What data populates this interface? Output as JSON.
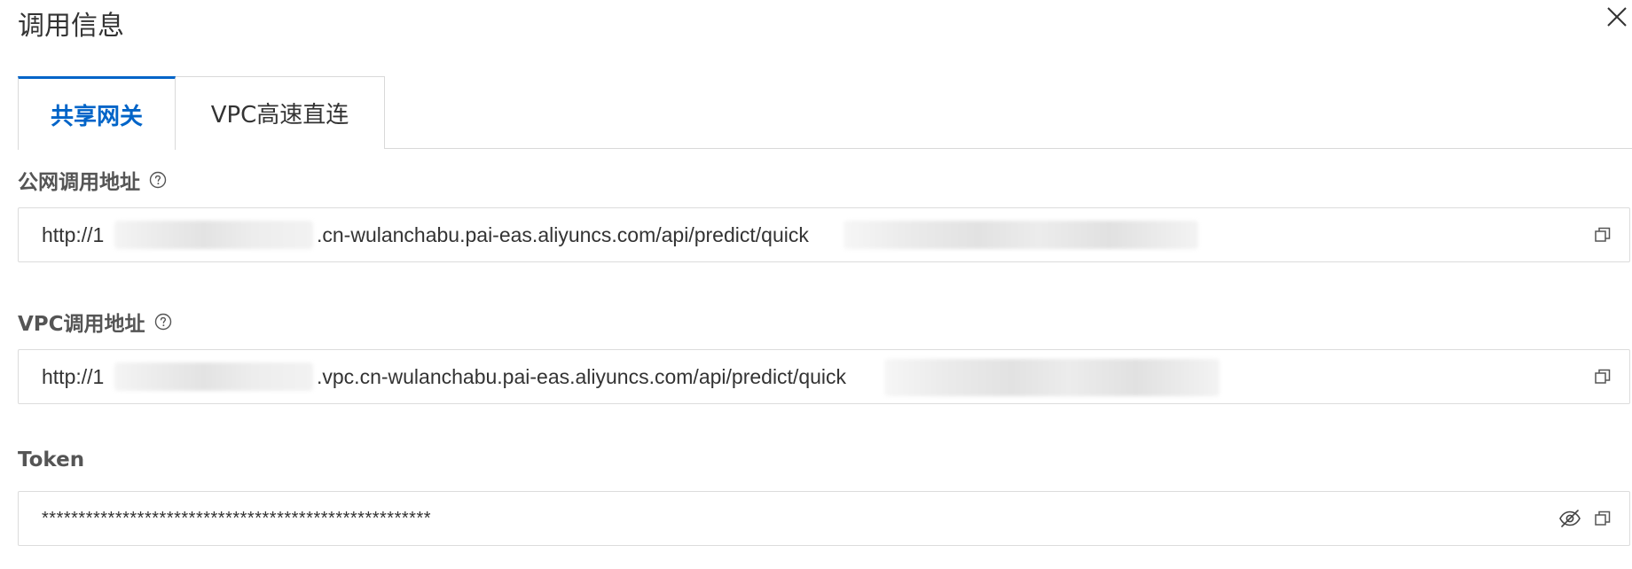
{
  "dialog": {
    "title": "调用信息"
  },
  "tabs": [
    {
      "label": "共享网关",
      "active": true
    },
    {
      "label": "VPC高速直连",
      "active": false
    }
  ],
  "fields": {
    "public": {
      "label": "公网调用地址",
      "value_prefix": "http://1",
      "value_middle": ".cn-wulanchabu.pai-eas.aliyuncs.com/api/predict/quick"
    },
    "vpc": {
      "label": "VPC调用地址",
      "value_prefix": "http://1",
      "value_middle": ".vpc.cn-wulanchabu.pai-eas.aliyuncs.com/api/predict/quick"
    },
    "token": {
      "label": "Token",
      "value": "*****************************************************"
    }
  },
  "icons": {
    "close": "close-icon",
    "help": "question-circle-icon",
    "copy": "copy-icon",
    "visibility": "eye-off-icon"
  },
  "colors": {
    "accent": "#0064c8",
    "text": "#333333",
    "label": "#555555",
    "border": "#d9d9d9"
  }
}
